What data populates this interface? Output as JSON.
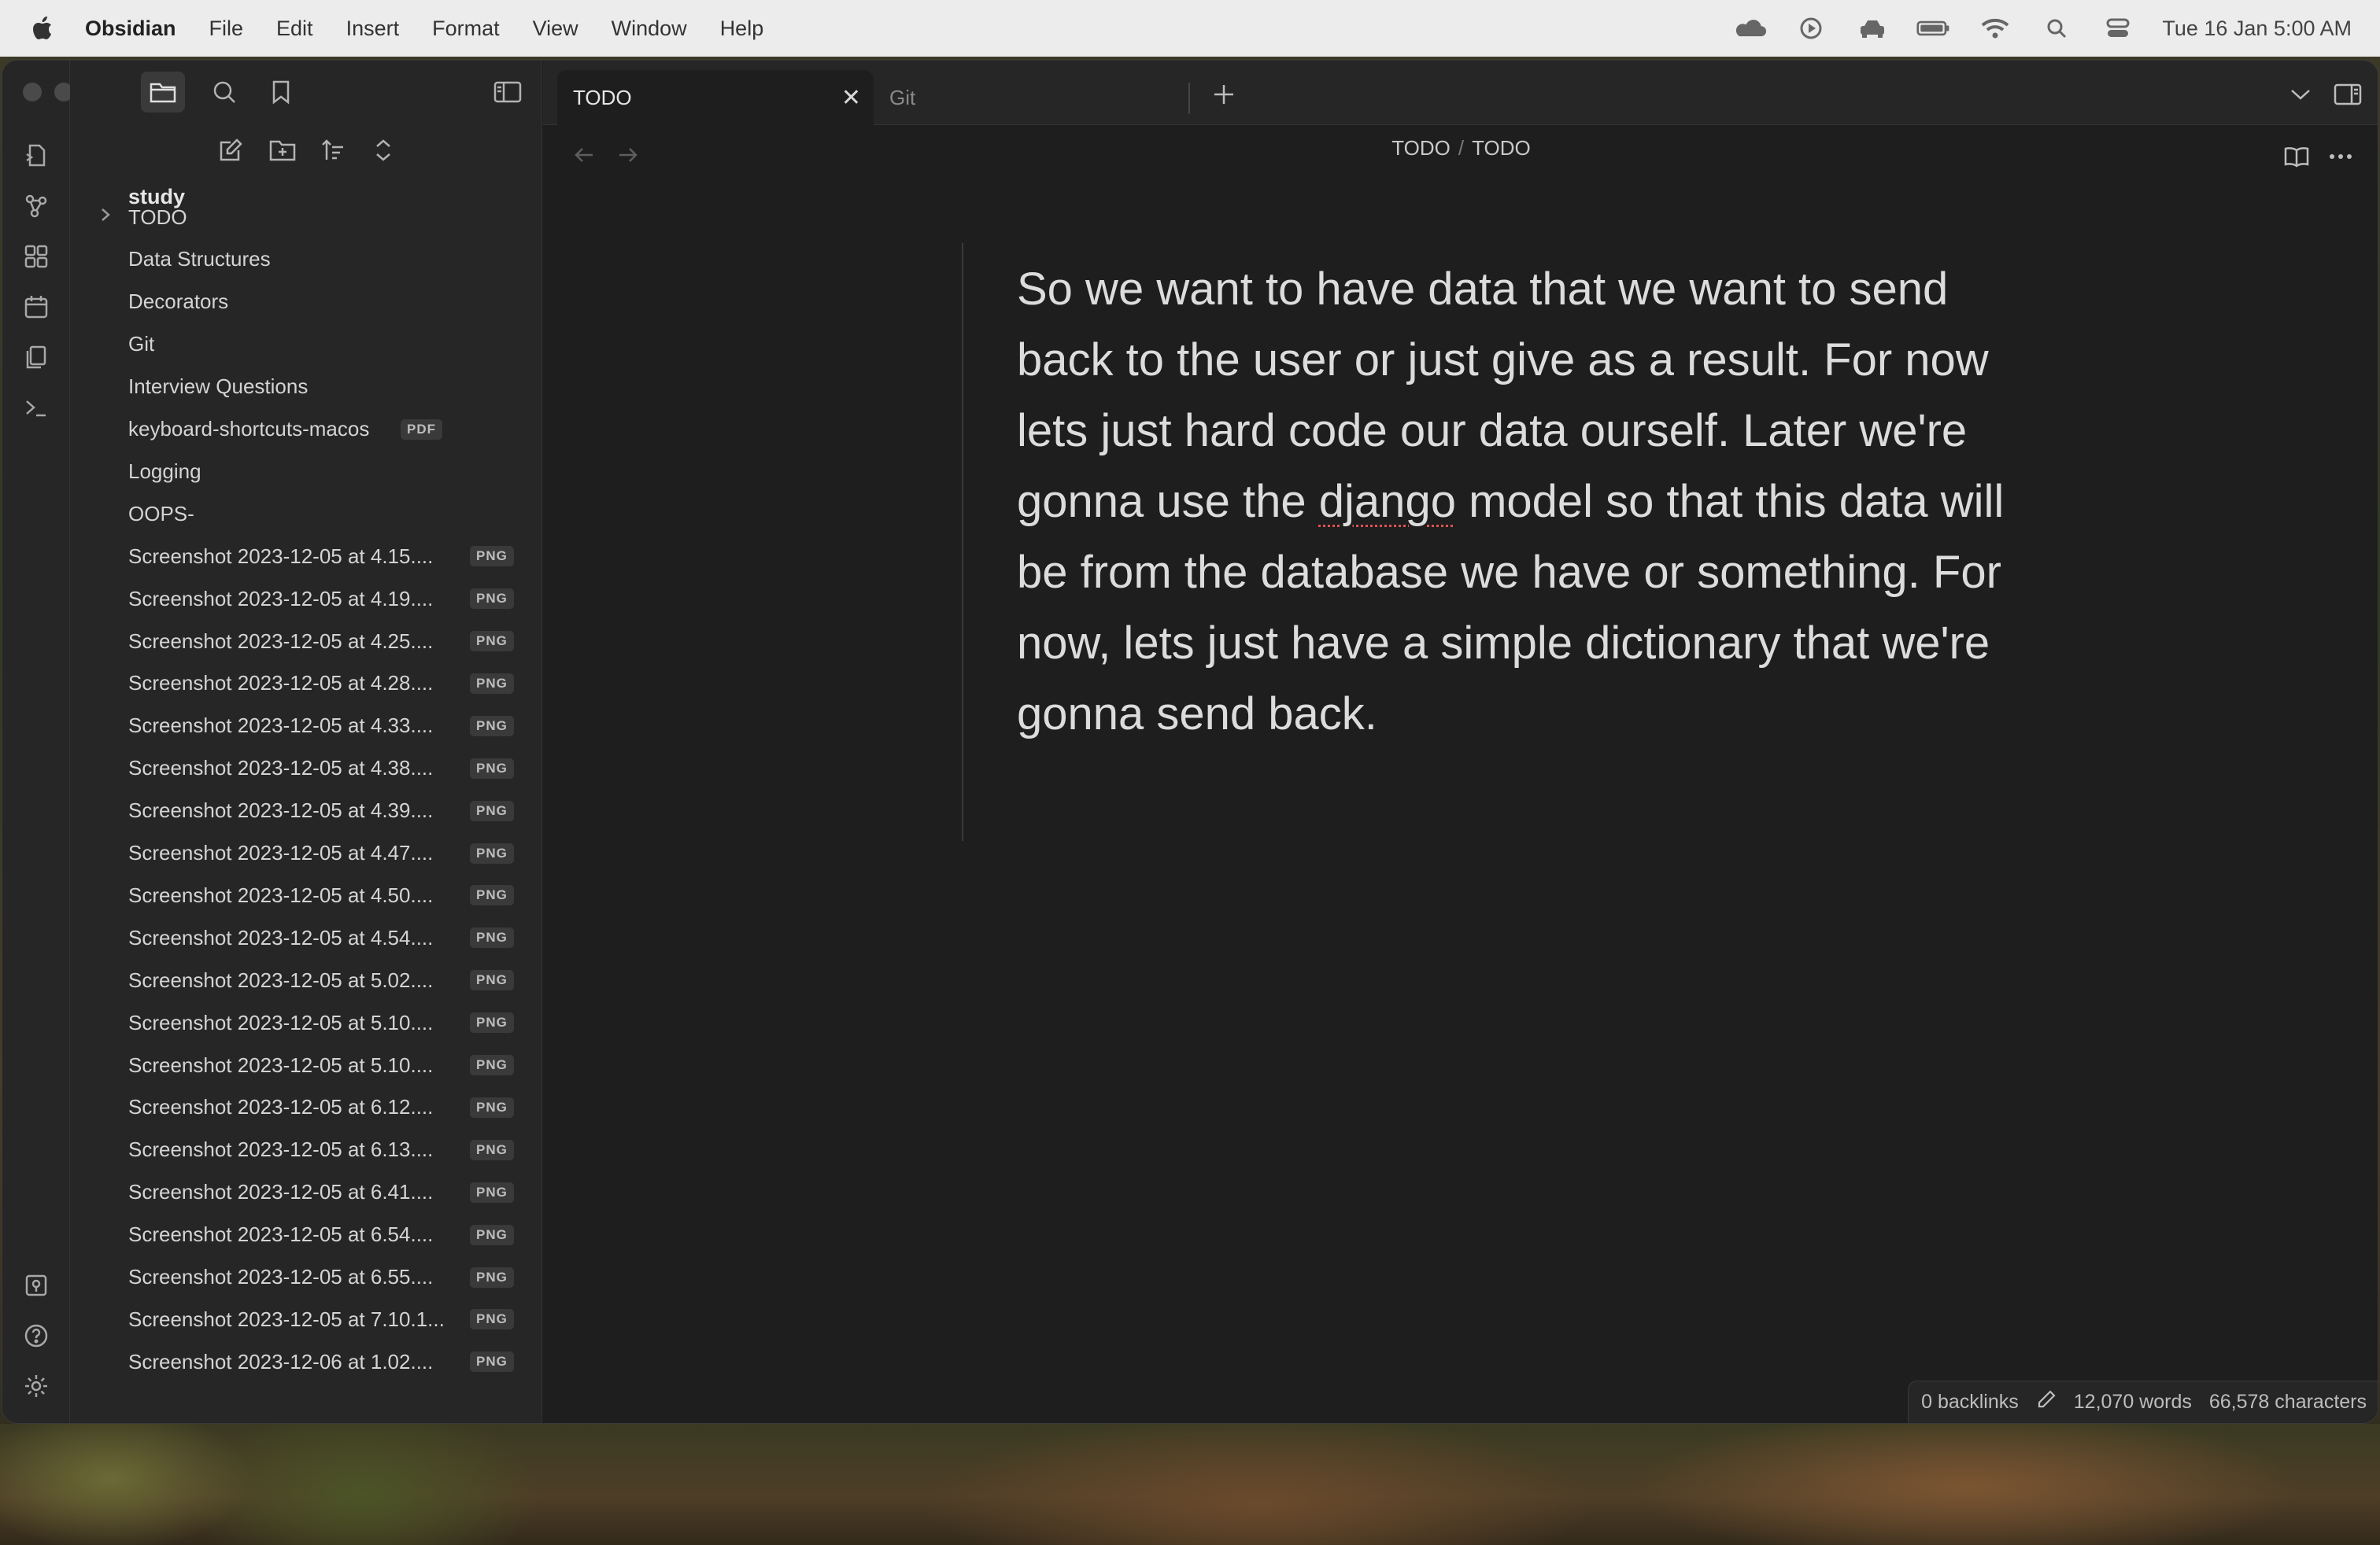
{
  "menubar": {
    "app_name": "Obsidian",
    "items": [
      "File",
      "Edit",
      "Insert",
      "Format",
      "View",
      "Window",
      "Help"
    ],
    "status_icons": [
      "cloud-icon",
      "play-circle-icon",
      "car-icon",
      "battery-icon",
      "wifi-icon",
      "spotlight-icon",
      "control-center-icon"
    ],
    "clock": "Tue 16 Jan  5:00 AM"
  },
  "sidebar": {
    "vault_name": "study",
    "files": [
      {
        "name": "TODO",
        "folder": true,
        "badge": ""
      },
      {
        "name": "Data Structures",
        "badge": ""
      },
      {
        "name": "Decorators",
        "badge": ""
      },
      {
        "name": "Git",
        "badge": ""
      },
      {
        "name": "Interview Questions",
        "badge": ""
      },
      {
        "name": "keyboard-shortcuts-macos",
        "badge": "PDF"
      },
      {
        "name": "Logging",
        "badge": ""
      },
      {
        "name": "OOPS-",
        "badge": ""
      },
      {
        "name": "Screenshot 2023-12-05 at 4.15....",
        "badge": "PNG"
      },
      {
        "name": "Screenshot 2023-12-05 at 4.19....",
        "badge": "PNG"
      },
      {
        "name": "Screenshot 2023-12-05 at 4.25....",
        "badge": "PNG"
      },
      {
        "name": "Screenshot 2023-12-05 at 4.28....",
        "badge": "PNG"
      },
      {
        "name": "Screenshot 2023-12-05 at 4.33....",
        "badge": "PNG"
      },
      {
        "name": "Screenshot 2023-12-05 at 4.38....",
        "badge": "PNG"
      },
      {
        "name": "Screenshot 2023-12-05 at 4.39....",
        "badge": "PNG"
      },
      {
        "name": "Screenshot 2023-12-05 at 4.47....",
        "badge": "PNG"
      },
      {
        "name": "Screenshot 2023-12-05 at 4.50....",
        "badge": "PNG"
      },
      {
        "name": "Screenshot 2023-12-05 at 4.54....",
        "badge": "PNG"
      },
      {
        "name": "Screenshot 2023-12-05 at 5.02....",
        "badge": "PNG"
      },
      {
        "name": "Screenshot 2023-12-05 at 5.10....",
        "badge": "PNG"
      },
      {
        "name": "Screenshot 2023-12-05 at 5.10....",
        "badge": "PNG"
      },
      {
        "name": "Screenshot 2023-12-05 at 6.12....",
        "badge": "PNG"
      },
      {
        "name": "Screenshot 2023-12-05 at 6.13....",
        "badge": "PNG"
      },
      {
        "name": "Screenshot 2023-12-05 at 6.41....",
        "badge": "PNG"
      },
      {
        "name": "Screenshot 2023-12-05 at 6.54....",
        "badge": "PNG"
      },
      {
        "name": "Screenshot 2023-12-05 at 6.55....",
        "badge": "PNG"
      },
      {
        "name": "Screenshot 2023-12-05 at 7.10.1...",
        "badge": "PNG"
      },
      {
        "name": "Screenshot 2023-12-06 at 1.02....",
        "badge": "PNG"
      }
    ]
  },
  "tabs": [
    {
      "label": "TODO",
      "active": true
    },
    {
      "label": "Git",
      "active": false
    }
  ],
  "breadcrumb": {
    "folder": "TODO",
    "separator": "/",
    "file": "TODO"
  },
  "note": {
    "before": "So we want to have data that we want to send back to the user or just give as a result. For now lets just hard code our data ourself. Later we're gonna use the ",
    "misspelled": "django",
    "after": " model so that this data will be from the database we have or something. For now, lets just have a simple dictionary that we're gonna send back."
  },
  "status": {
    "backlinks": "0 backlinks",
    "words": "12,070 words",
    "characters": "66,578 characters"
  }
}
